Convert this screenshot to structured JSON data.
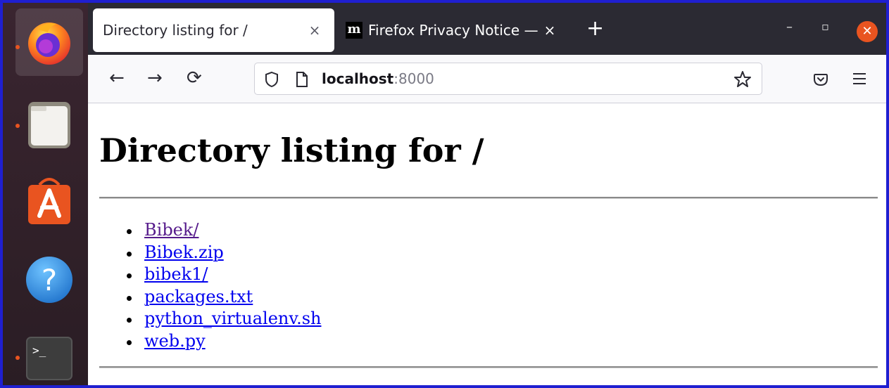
{
  "dock": {
    "items": [
      {
        "name": "firefox",
        "running": true,
        "active": true
      },
      {
        "name": "files",
        "running": true,
        "active": false
      },
      {
        "name": "app-center",
        "running": false,
        "active": false
      },
      {
        "name": "help",
        "running": false,
        "active": false
      },
      {
        "name": "terminal",
        "running": true,
        "active": false
      }
    ],
    "help_glyph": "?",
    "terminal_glyph": ">_"
  },
  "browser": {
    "tabs": [
      {
        "title": "Directory listing for /",
        "close": "×",
        "active": true
      },
      {
        "favicon": "m",
        "title": "Firefox Privacy Notice —",
        "close": "×",
        "active": false
      }
    ],
    "new_tab_label": "+",
    "window_controls": {
      "minimize": "–",
      "restore": "▫",
      "close": "✕"
    },
    "nav": {
      "back": "←",
      "forward": "→",
      "reload": "⟳"
    },
    "url": {
      "host": "localhost",
      "port": ":8000"
    }
  },
  "page": {
    "heading": "Directory listing for /",
    "files": [
      {
        "name": "Bibek/",
        "visited": true
      },
      {
        "name": "Bibek.zip",
        "visited": false
      },
      {
        "name": "bibek1/",
        "visited": false
      },
      {
        "name": "packages.txt",
        "visited": false
      },
      {
        "name": "python_virtualenv.sh",
        "visited": false
      },
      {
        "name": "web.py",
        "visited": false
      }
    ]
  },
  "colors": {
    "accent": "#e95420",
    "link": "#0000ee",
    "visited_link": "#551a8b",
    "tabbar": "#2b2a33",
    "frame_border": "#1f1fd0"
  }
}
